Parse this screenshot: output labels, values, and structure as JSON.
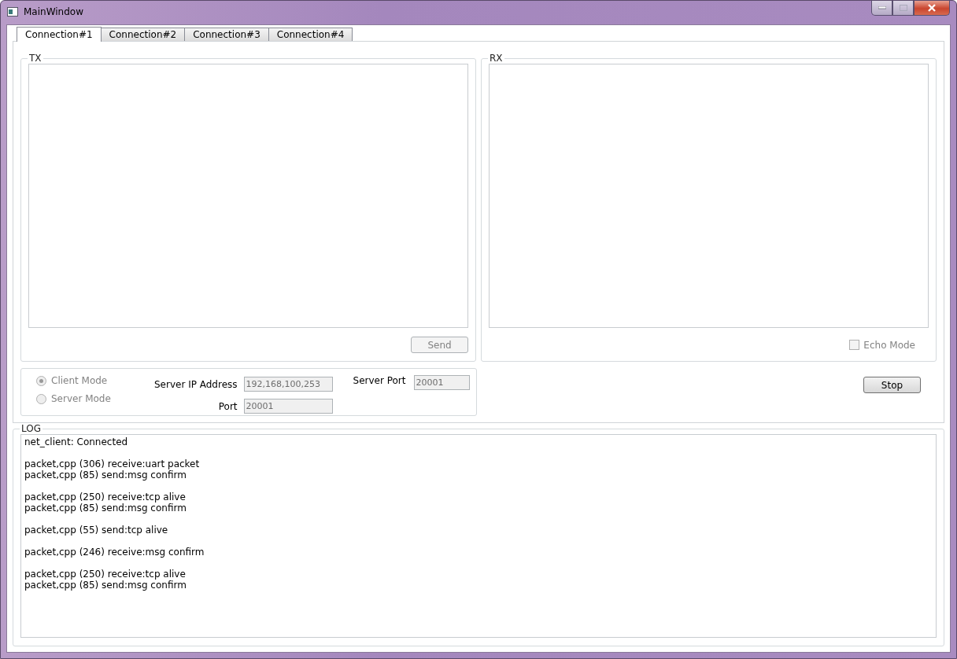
{
  "window": {
    "title": "MainWindow"
  },
  "tabs": [
    {
      "label": "Connection#1",
      "selected": true
    },
    {
      "label": "Connection#2",
      "selected": false
    },
    {
      "label": "Connection#3",
      "selected": false
    },
    {
      "label": "Connection#4",
      "selected": false
    }
  ],
  "tx": {
    "title": "TX",
    "send_button": {
      "label": "Send",
      "disabled": true
    }
  },
  "rx": {
    "title": "RX",
    "echo_mode": {
      "label": "Echo Mode",
      "checked": false,
      "disabled": true
    }
  },
  "settings": {
    "modes": [
      {
        "label": "Client Mode",
        "selected": true,
        "disabled": true
      },
      {
        "label": "Server Mode",
        "selected": false,
        "disabled": true
      }
    ],
    "server_ip": {
      "label": "Server IP Address",
      "value": "192,168,100,253",
      "disabled": true
    },
    "port": {
      "label": "Port",
      "value": "20001",
      "disabled": true
    },
    "server_port": {
      "label": "Server Port",
      "value": "20001",
      "disabled": true
    }
  },
  "stop_button": {
    "label": "Stop",
    "disabled": false
  },
  "log": {
    "title": "LOG",
    "groups": [
      [
        "net_client: Connected"
      ],
      [
        "packet,cpp (306) receive:uart packet",
        "packet,cpp (85) send:msg confirm"
      ],
      [
        "packet,cpp (250) receive:tcp alive",
        "packet,cpp (85) send:msg confirm"
      ],
      [
        "packet,cpp (55) send:tcp alive"
      ],
      [
        "packet,cpp (246) receive:msg confirm"
      ],
      [
        "packet,cpp (250) receive:tcp alive",
        "packet,cpp (85) send:msg confirm"
      ]
    ]
  }
}
